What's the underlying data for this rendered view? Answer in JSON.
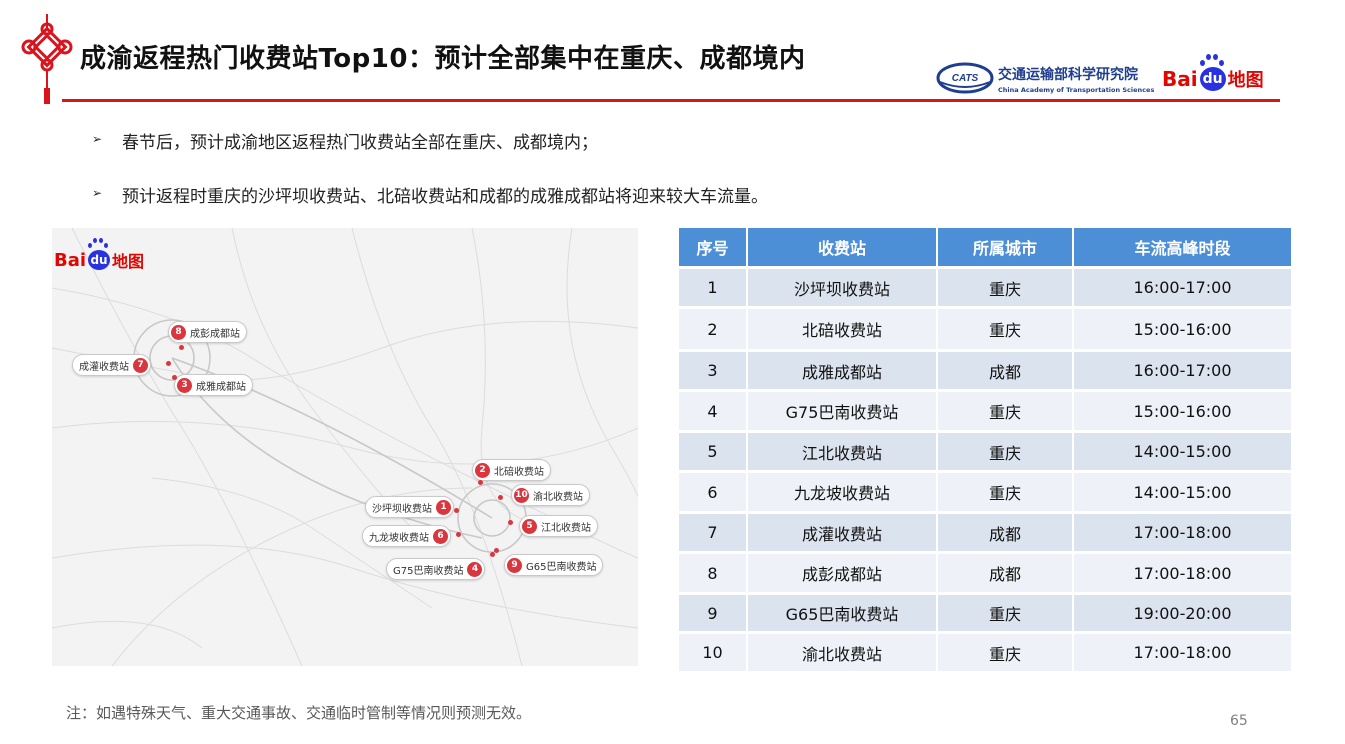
{
  "header": {
    "title": "成渝返程热门收费站Top10：预计全部集中在重庆、成都境内",
    "cats_name_cn": "交通运输部科学研究院",
    "cats_name_en": "China Academy of Transportation Sciences",
    "cats_logo_text": "CATS",
    "baidu_bai": "Bai",
    "baidu_du": "du",
    "baidu_ditu": "地图"
  },
  "bullets": [
    "春节后，预计成渝地区返程热门收费站全部在重庆、成都境内；",
    "预计返程时重庆的沙坪坝收费站、北碚收费站和成都的成雅成都站将迎来较大车流量。"
  ],
  "bullet_marker": "➢",
  "map": {
    "baidu_bai": "Bai",
    "baidu_du": "du",
    "baidu_ditu": "地图",
    "markers": [
      {
        "num": "8",
        "label": "成彭成都站"
      },
      {
        "num": "7",
        "label": "成灌收费站"
      },
      {
        "num": "3",
        "label": "成雅成都站"
      },
      {
        "num": "2",
        "label": "北碚收费站"
      },
      {
        "num": "10",
        "label": "渝北收费站"
      },
      {
        "num": "1",
        "label": "沙坪坝收费站"
      },
      {
        "num": "5",
        "label": "江北收费站"
      },
      {
        "num": "6",
        "label": "九龙坡收费站"
      },
      {
        "num": "9",
        "label": "G65巴南收费站"
      },
      {
        "num": "4",
        "label": "G75巴南收费站"
      }
    ]
  },
  "table": {
    "headers": [
      "序号",
      "收费站",
      "所属城市",
      "车流高峰时段"
    ],
    "rows": [
      [
        "1",
        "沙坪坝收费站",
        "重庆",
        "16:00-17:00"
      ],
      [
        "2",
        "北碚收费站",
        "重庆",
        "15:00-16:00"
      ],
      [
        "3",
        "成雅成都站",
        "成都",
        "16:00-17:00"
      ],
      [
        "4",
        "G75巴南收费站",
        "重庆",
        "15:00-16:00"
      ],
      [
        "5",
        "江北收费站",
        "重庆",
        "14:00-15:00"
      ],
      [
        "6",
        "九龙坡收费站",
        "重庆",
        "14:00-15:00"
      ],
      [
        "7",
        "成灌收费站",
        "成都",
        "17:00-18:00"
      ],
      [
        "8",
        "成彭成都站",
        "成都",
        "17:00-18:00"
      ],
      [
        "9",
        "G65巴南收费站",
        "重庆",
        "19:00-20:00"
      ],
      [
        "10",
        "渝北收费站",
        "重庆",
        "17:00-18:00"
      ]
    ]
  },
  "note": "注：如遇特殊天气、重大交通事故、交通临时管制等情况则预测无效。",
  "page_number": "65",
  "colors": {
    "accent_red": "#d9141d",
    "table_header": "#4d8fd6",
    "row_odd": "#dbe3ef",
    "row_even": "#eef2f8",
    "marker_red": "#d9363e",
    "cats_blue": "#1f3e8f"
  }
}
